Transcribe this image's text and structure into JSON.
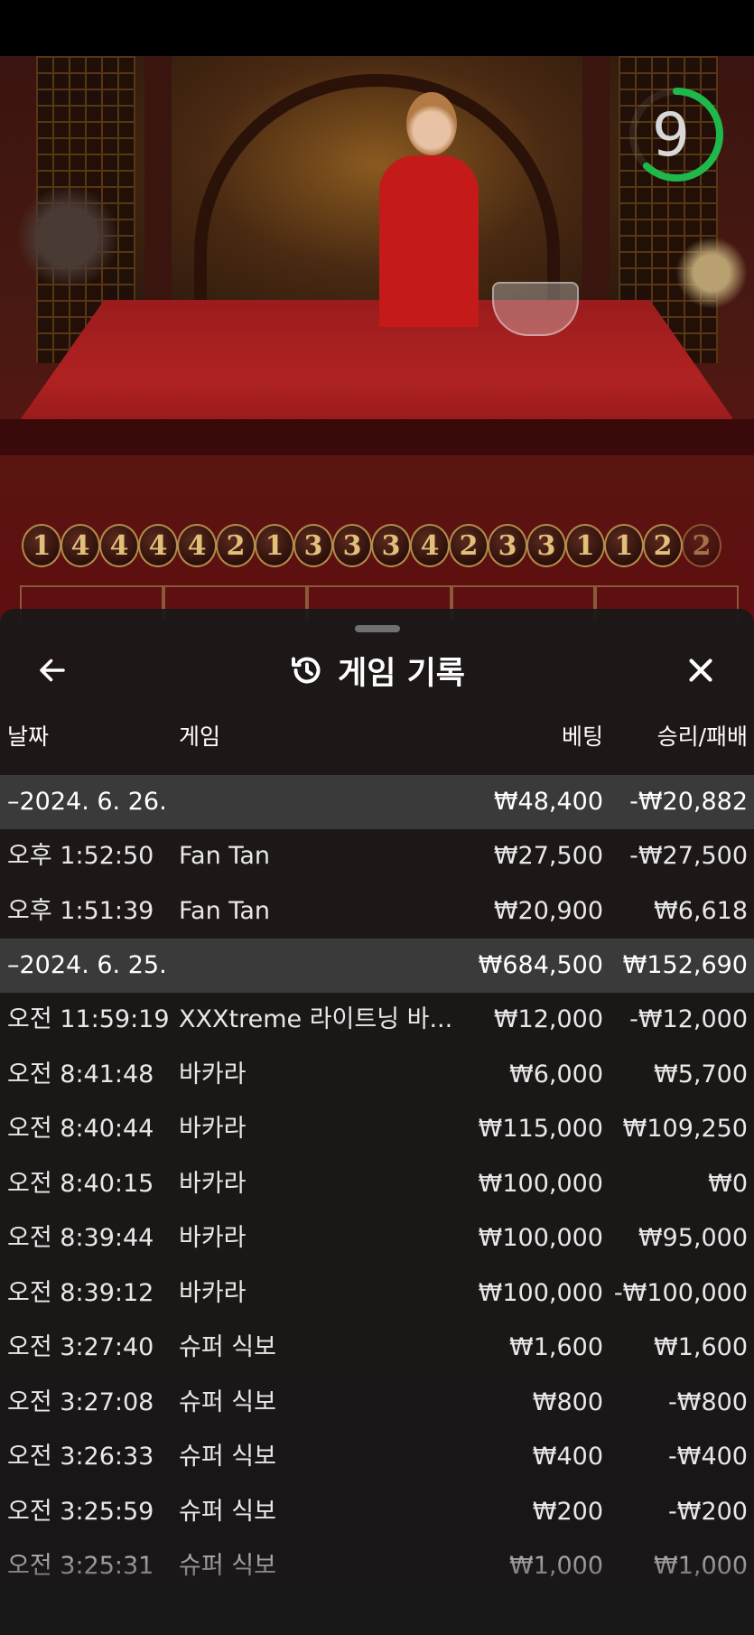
{
  "timer": {
    "value": "9",
    "progress": 0.62,
    "color": "#1fb84a"
  },
  "road": {
    "numbers": [
      "1",
      "4",
      "4",
      "4",
      "4",
      "2",
      "1",
      "3",
      "3",
      "3",
      "4",
      "2",
      "3",
      "3",
      "1",
      "1",
      "2",
      "2"
    ],
    "accent": "#e2c07a"
  },
  "sheet": {
    "title": "게임 기록",
    "back_icon": "back-arrow-icon",
    "title_icon": "history-icon",
    "close_icon": "close-icon",
    "columns": {
      "date": "날짜",
      "game": "게임",
      "bet": "베팅",
      "winloss": "승리/패배"
    },
    "groups": [
      {
        "date": "–2024. 6. 26.",
        "bet": "₩48,400",
        "winloss": "-₩20,882",
        "rows": [
          {
            "time": "오후 1:52:50",
            "game": "Fan Tan",
            "bet": "₩27,500",
            "winloss": "-₩27,500"
          },
          {
            "time": "오후 1:51:39",
            "game": "Fan Tan",
            "bet": "₩20,900",
            "winloss": "₩6,618"
          }
        ]
      },
      {
        "date": "–2024. 6. 25.",
        "bet": "₩684,500",
        "winloss": "₩152,690",
        "rows": [
          {
            "time": "오전 11:59:19",
            "game": "XXXtreme 라이트닝 바...",
            "bet": "₩12,000",
            "winloss": "-₩12,000"
          },
          {
            "time": "오전 8:41:48",
            "game": "바카라",
            "bet": "₩6,000",
            "winloss": "₩5,700"
          },
          {
            "time": "오전 8:40:44",
            "game": "바카라",
            "bet": "₩115,000",
            "winloss": "₩109,250"
          },
          {
            "time": "오전 8:40:15",
            "game": "바카라",
            "bet": "₩100,000",
            "winloss": "₩0"
          },
          {
            "time": "오전 8:39:44",
            "game": "바카라",
            "bet": "₩100,000",
            "winloss": "₩95,000"
          },
          {
            "time": "오전 8:39:12",
            "game": "바카라",
            "bet": "₩100,000",
            "winloss": "-₩100,000"
          },
          {
            "time": "오전 3:27:40",
            "game": "슈퍼 식보",
            "bet": "₩1,600",
            "winloss": "₩1,600"
          },
          {
            "time": "오전 3:27:08",
            "game": "슈퍼 식보",
            "bet": "₩800",
            "winloss": "-₩800"
          },
          {
            "time": "오전 3:26:33",
            "game": "슈퍼 식보",
            "bet": "₩400",
            "winloss": "-₩400"
          },
          {
            "time": "오전 3:25:59",
            "game": "슈퍼 식보",
            "bet": "₩200",
            "winloss": "-₩200"
          },
          {
            "time": "오전 3:25:31",
            "game": "슈퍼 식보",
            "bet": "₩1,000",
            "winloss": "₩1,000"
          }
        ]
      }
    ]
  }
}
